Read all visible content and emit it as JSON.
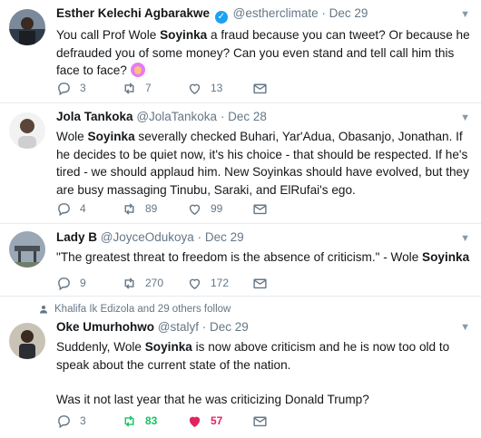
{
  "tweets": [
    {
      "name": "Esther Kelechi Agbarakwe",
      "handle": "@estherclimate",
      "dot": "·",
      "date": "Dec 29",
      "text_before": "You call Prof Wole ",
      "text_bold": "Soyinka",
      "text_after": " a fraud because you can tweet? Or because he defrauded you of some money? Can you even stand and tell call him this face to face? ",
      "emoji": "person-gesturing-face-emoji",
      "replies": "3",
      "retweets": "7",
      "likes": "13"
    },
    {
      "name": "Jola Tankoka",
      "handle": "@JolaTankoka",
      "dot": "·",
      "date": "Dec 28",
      "text_before": "Wole ",
      "text_bold": "Soyinka",
      "text_after": " severally checked Buhari, Yar'Adua, Obasanjo, Jonathan. If he decides to be quiet now, it's his choice - that should be respected. If he's tired - we should applaud him. New Soyinkas should have evolved, but they are busy massaging Tinubu, Saraki, and ElRufai's ego.",
      "replies": "4",
      "retweets": "89",
      "likes": "99"
    },
    {
      "name": "Lady B",
      "handle": "@JoyceOdukoya",
      "dot": "·",
      "date": "Dec 29",
      "text_before": "\"The greatest threat to freedom is the absence of criticism.\" - Wole ",
      "text_bold": "Soyinka",
      "text_after": "",
      "replies": "9",
      "retweets": "270",
      "likes": "172"
    },
    {
      "social_context": "Khalifa Ik Edizola and 29 others follow",
      "name": "Oke Umurhohwo",
      "handle": "@stalyf",
      "dot": "·",
      "date": "Dec 29",
      "text_before": "Suddenly, Wole ",
      "text_bold": "Soyinka",
      "text_after": " is now above criticism and he is now too old to speak about the current state of the nation.",
      "text_line2": "Was it not last year that he was criticizing Donald Trump?",
      "replies": "3",
      "retweets": "83",
      "likes": "57"
    }
  ],
  "colors": {
    "text": "#14171a",
    "muted": "#657786",
    "verified": "#1da1f2",
    "retweet_active": "#17bf63",
    "like_active": "#e0245e",
    "divider": "#e6ecf0"
  },
  "icons": {
    "reply": "reply-icon",
    "retweet": "retweet-icon",
    "like": "heart-icon",
    "dm": "envelope-icon",
    "caret": "chevron-down-icon",
    "verified": "verified-badge-icon",
    "follow": "person-icon"
  }
}
